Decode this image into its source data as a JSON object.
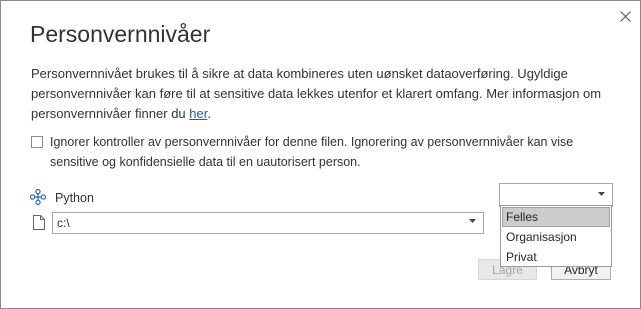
{
  "dialog": {
    "title": "Personvernnivåer",
    "description_text": "Personvernnivået brukes til å sikre at data kombineres uten uønsket dataoverføring. Ugyldige personvernnivåer kan føre til at sensitive data lekkes utenfor et klarert omfang. Mer informasjon om personvernnivåer finner du ",
    "description_link": "her",
    "description_end": ".",
    "ignore_checkbox": {
      "checked": false,
      "label": "Ignorer kontroller av personvernnivåer for denne filen. Ignorering av personvernnivåer kan vise sensitive og konfidensielle data til en uautorisert person."
    },
    "source": {
      "icon": "python-icon",
      "name": "Python",
      "path_value": "c:\\",
      "privacy_level_value": ""
    },
    "privacy_dropdown": {
      "options": [
        "Felles",
        "Organisasjon",
        "Privat"
      ],
      "highlighted": "Felles"
    },
    "buttons": {
      "ok_label": "Lagre",
      "cancel_label": "Avbryt"
    },
    "colors": {
      "link": "#1f5fb5",
      "python_icon": "#2f6db5",
      "highlight": "#cccccc"
    }
  }
}
